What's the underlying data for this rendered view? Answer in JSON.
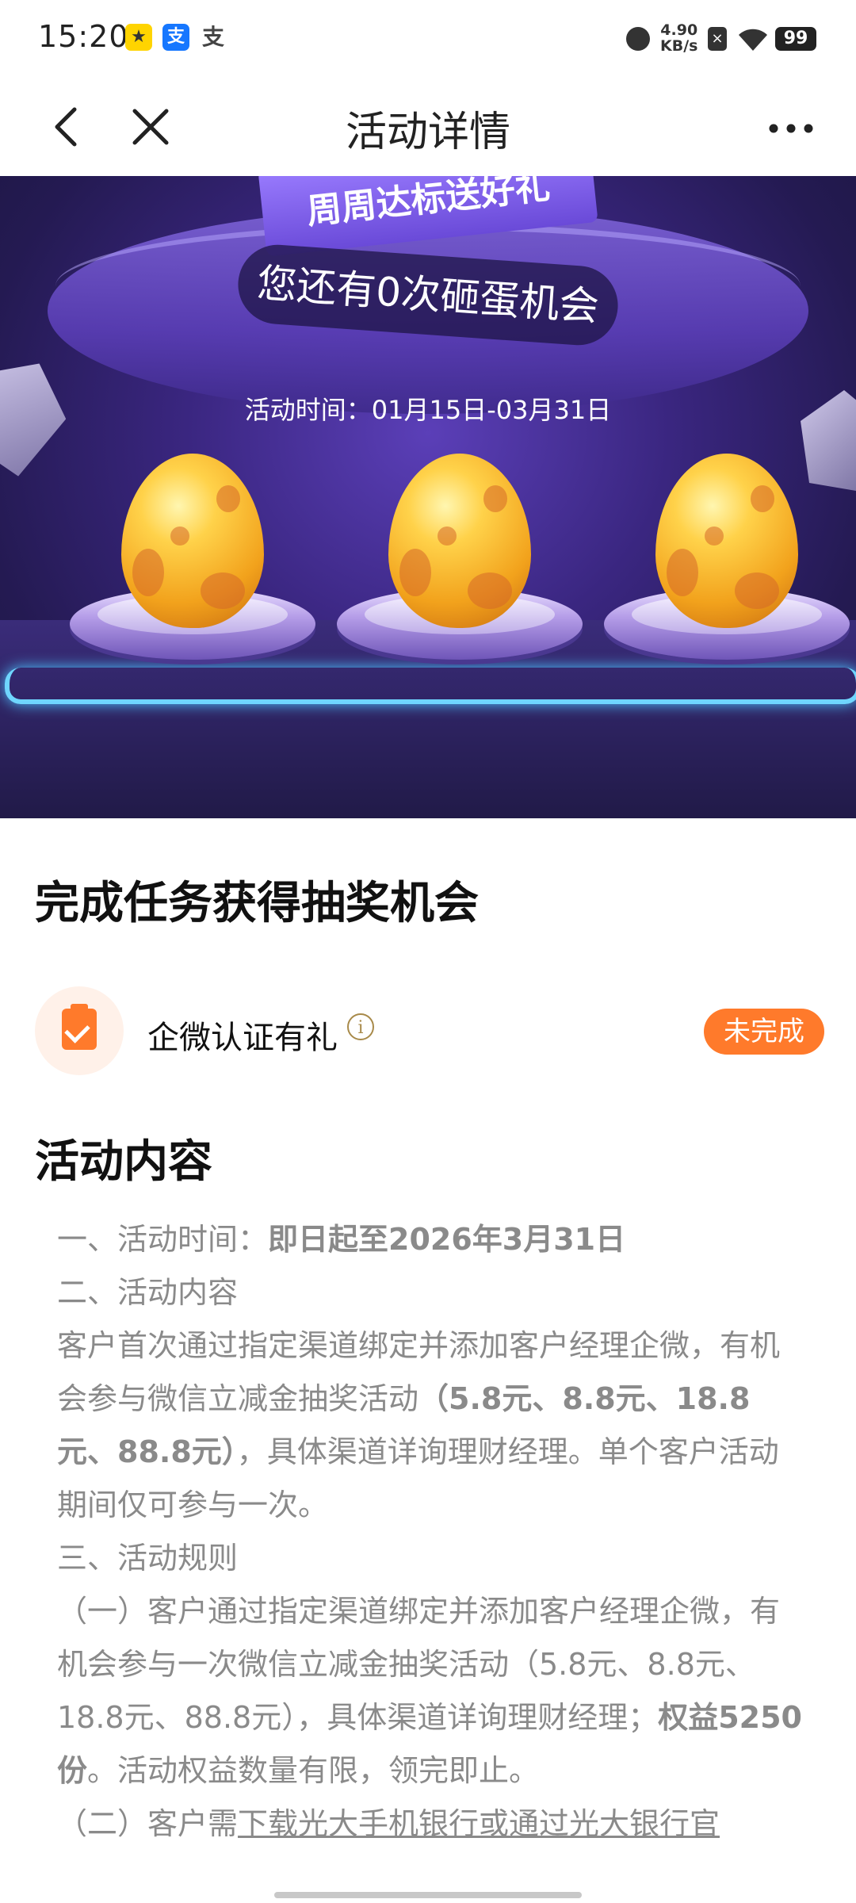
{
  "status_bar": {
    "time": "15:20",
    "notif_icons": [
      "招商",
      "支",
      "支"
    ],
    "net_speed_value": "4.90",
    "net_speed_unit": "KB/s",
    "battery": "99"
  },
  "nav": {
    "title": "活动详情"
  },
  "banner": {
    "ribbon_text": "周周达标送好礼",
    "chance_text": "您还有0次砸蛋机会",
    "period_text": "活动时间：01月15日-03月31日",
    "egg_count": 3
  },
  "task_section": {
    "title": "完成任务获得抽奖机会",
    "task_label": "企微认证有礼",
    "task_status": "未完成",
    "accent_color": "#ff7a2b"
  },
  "content_section": {
    "title": "活动内容",
    "l1_pre": "一、活动时间：",
    "l1_bold": "即日起至2026年3月31日",
    "l2": "二、活动内容",
    "p2_a": "客户首次通过指定渠道绑定并添加客户经理企微，有机会参与微信立减金抽奖活动",
    "p2_bold": "（5.8元、8.8元、18.8元、88.8元）",
    "p2_b": "，具体渠道详询理财经理。单个客户活动期间仅可参与一次。",
    "l3": "三、活动规则",
    "p3_a": "（一）客户通过指定渠道绑定并添加客户经理企微，有机会参与一次微信立减金抽奖活动（5.8元、8.8元、18.8元、88.8元），具体渠道详询理财经理；",
    "p3_bold": "权益5250份",
    "p3_b": "。活动权益数量有限，领完即止。",
    "p4_a": "（二）客户需",
    "p4_underline": "下载光大手机银行或通过光大银行官"
  }
}
